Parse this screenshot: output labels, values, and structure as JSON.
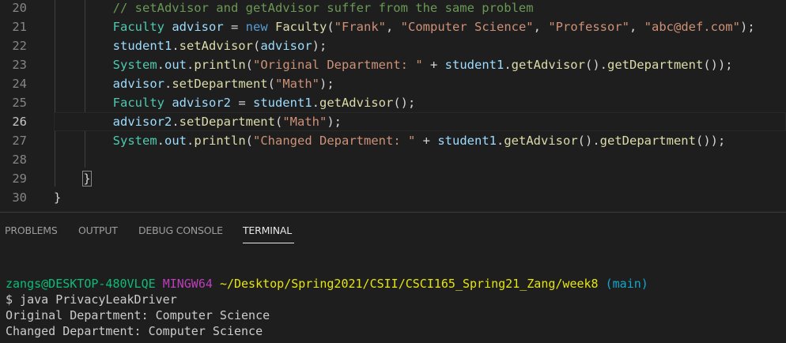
{
  "editor": {
    "lines": [
      {
        "num": "20",
        "active": false,
        "tokens": [
          {
            "t": "        ",
            "c": "plain"
          },
          {
            "t": "// setAdvisor and getAdvisor suffer from the same problem",
            "c": "comment"
          }
        ]
      },
      {
        "num": "21",
        "active": false,
        "tokens": [
          {
            "t": "        ",
            "c": "plain"
          },
          {
            "t": "Faculty",
            "c": "type"
          },
          {
            "t": " ",
            "c": "plain"
          },
          {
            "t": "advisor",
            "c": "var"
          },
          {
            "t": " = ",
            "c": "plain"
          },
          {
            "t": "new",
            "c": "kw"
          },
          {
            "t": " ",
            "c": "plain"
          },
          {
            "t": "Faculty",
            "c": "fn"
          },
          {
            "t": "(",
            "c": "plain"
          },
          {
            "t": "\"Frank\"",
            "c": "str"
          },
          {
            "t": ", ",
            "c": "plain"
          },
          {
            "t": "\"Computer Science\"",
            "c": "str"
          },
          {
            "t": ", ",
            "c": "plain"
          },
          {
            "t": "\"Professor\"",
            "c": "str"
          },
          {
            "t": ", ",
            "c": "plain"
          },
          {
            "t": "\"abc@def.com\"",
            "c": "str"
          },
          {
            "t": ");",
            "c": "plain"
          }
        ]
      },
      {
        "num": "22",
        "active": false,
        "tokens": [
          {
            "t": "        ",
            "c": "plain"
          },
          {
            "t": "student1",
            "c": "var"
          },
          {
            "t": ".",
            "c": "plain"
          },
          {
            "t": "setAdvisor",
            "c": "fn"
          },
          {
            "t": "(",
            "c": "plain"
          },
          {
            "t": "advisor",
            "c": "var"
          },
          {
            "t": ");",
            "c": "plain"
          }
        ]
      },
      {
        "num": "23",
        "active": false,
        "tokens": [
          {
            "t": "        ",
            "c": "plain"
          },
          {
            "t": "System",
            "c": "type"
          },
          {
            "t": ".",
            "c": "plain"
          },
          {
            "t": "out",
            "c": "var"
          },
          {
            "t": ".",
            "c": "plain"
          },
          {
            "t": "println",
            "c": "fn"
          },
          {
            "t": "(",
            "c": "plain"
          },
          {
            "t": "\"Original Department: \"",
            "c": "str"
          },
          {
            "t": " + ",
            "c": "plain"
          },
          {
            "t": "student1",
            "c": "var"
          },
          {
            "t": ".",
            "c": "plain"
          },
          {
            "t": "getAdvisor",
            "c": "fn"
          },
          {
            "t": "().",
            "c": "plain"
          },
          {
            "t": "getDepartment",
            "c": "fn"
          },
          {
            "t": "());",
            "c": "plain"
          }
        ]
      },
      {
        "num": "24",
        "active": false,
        "tokens": [
          {
            "t": "        ",
            "c": "plain"
          },
          {
            "t": "advisor",
            "c": "var"
          },
          {
            "t": ".",
            "c": "plain"
          },
          {
            "t": "setDepartment",
            "c": "fn"
          },
          {
            "t": "(",
            "c": "plain"
          },
          {
            "t": "\"Math\"",
            "c": "str"
          },
          {
            "t": ");",
            "c": "plain"
          }
        ]
      },
      {
        "num": "25",
        "active": false,
        "tokens": [
          {
            "t": "        ",
            "c": "plain"
          },
          {
            "t": "Faculty",
            "c": "type"
          },
          {
            "t": " ",
            "c": "plain"
          },
          {
            "t": "advisor2",
            "c": "var"
          },
          {
            "t": " = ",
            "c": "plain"
          },
          {
            "t": "student1",
            "c": "var"
          },
          {
            "t": ".",
            "c": "plain"
          },
          {
            "t": "getAdvisor",
            "c": "fn"
          },
          {
            "t": "();",
            "c": "plain"
          }
        ]
      },
      {
        "num": "26",
        "active": true,
        "tokens": [
          {
            "t": "        ",
            "c": "plain"
          },
          {
            "t": "advisor2",
            "c": "var"
          },
          {
            "t": ".",
            "c": "plain"
          },
          {
            "t": "setDepartment",
            "c": "fn"
          },
          {
            "t": "(",
            "c": "plain"
          },
          {
            "t": "\"Math\"",
            "c": "str"
          },
          {
            "t": ");",
            "c": "plain"
          }
        ]
      },
      {
        "num": "27",
        "active": false,
        "tokens": [
          {
            "t": "        ",
            "c": "plain"
          },
          {
            "t": "System",
            "c": "type"
          },
          {
            "t": ".",
            "c": "plain"
          },
          {
            "t": "out",
            "c": "var"
          },
          {
            "t": ".",
            "c": "plain"
          },
          {
            "t": "println",
            "c": "fn"
          },
          {
            "t": "(",
            "c": "plain"
          },
          {
            "t": "\"Changed Department: \"",
            "c": "str"
          },
          {
            "t": " + ",
            "c": "plain"
          },
          {
            "t": "student1",
            "c": "var"
          },
          {
            "t": ".",
            "c": "plain"
          },
          {
            "t": "getAdvisor",
            "c": "fn"
          },
          {
            "t": "().",
            "c": "plain"
          },
          {
            "t": "getDepartment",
            "c": "fn"
          },
          {
            "t": "());",
            "c": "plain"
          }
        ]
      },
      {
        "num": "28",
        "active": false,
        "tokens": []
      },
      {
        "num": "29",
        "active": false,
        "tokens": [
          {
            "t": "    ",
            "c": "plain"
          },
          {
            "t": "}",
            "c": "brace"
          }
        ]
      },
      {
        "num": "30",
        "active": false,
        "tokens": [
          {
            "t": "}",
            "c": "plain"
          }
        ]
      }
    ]
  },
  "panel": {
    "tabs": [
      {
        "label": "PROBLEMS",
        "active": false
      },
      {
        "label": "OUTPUT",
        "active": false
      },
      {
        "label": "DEBUG CONSOLE",
        "active": false
      },
      {
        "label": "TERMINAL",
        "active": true
      }
    ]
  },
  "terminal": {
    "prompt_user": "zangs@DESKTOP-480VLQE",
    "prompt_shell": "MINGW64",
    "prompt_path": "~/Desktop/Spring2021/CSII/CSCI165_Spring21_Zang/week8",
    "prompt_branch": "(main)",
    "command": "$ java PrivacyLeakDriver",
    "output_line_1": "Original Department: Computer Science",
    "output_line_2": "Changed Department: Computer Science"
  },
  "colors": {
    "background": "#1e1e1e",
    "comment": "#6a9955",
    "type": "#4ec9b0",
    "variable": "#9cdcfe",
    "keyword": "#569cd6",
    "string": "#ce9178",
    "function": "#dcdcaa",
    "terminal_user": "#0dbc79",
    "terminal_shell": "#bc3fbc",
    "terminal_path": "#e5e510",
    "terminal_branch": "#11a8cd"
  }
}
